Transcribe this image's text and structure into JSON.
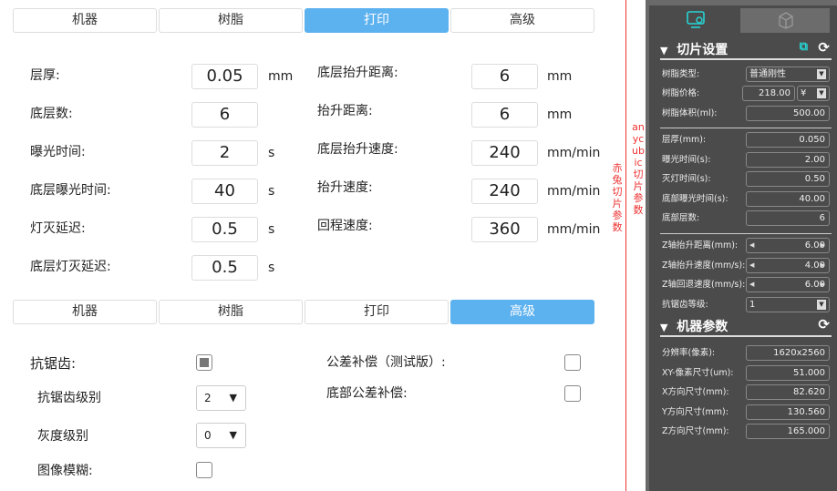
{
  "tabs_top": [
    "机器",
    "树脂",
    "打印",
    "高级"
  ],
  "print": {
    "left": [
      {
        "label": "层厚:",
        "value": "0.05",
        "unit": "mm"
      },
      {
        "label": "底层数:",
        "value": "6",
        "unit": ""
      },
      {
        "label": "曝光时间:",
        "value": "2",
        "unit": "s"
      },
      {
        "label": "底层曝光时间:",
        "value": "40",
        "unit": "s"
      },
      {
        "label": "灯灭延迟:",
        "value": "0.5",
        "unit": "s"
      },
      {
        "label": "底层灯灭延迟:",
        "value": "0.5",
        "unit": "s"
      }
    ],
    "right": [
      {
        "label": "底层抬升距离:",
        "value": "6",
        "unit": "mm"
      },
      {
        "label": "抬升距离:",
        "value": "6",
        "unit": "mm"
      },
      {
        "label": "底层抬升速度:",
        "value": "240",
        "unit": "mm/min"
      },
      {
        "label": "抬升速度:",
        "value": "240",
        "unit": "mm/min"
      },
      {
        "label": "回程速度:",
        "value": "360",
        "unit": "mm/min"
      }
    ]
  },
  "tabs_bottom": [
    "机器",
    "树脂",
    "打印",
    "高级"
  ],
  "advanced": {
    "antialias": "抗锯齿:",
    "antialias_level": "抗锯齿级别",
    "antialias_level_value": "2",
    "gray_level": "灰度级别",
    "gray_level_value": "0",
    "blur": "图像模糊:",
    "tolerance": "公差补偿（测试版）:",
    "bottom_tolerance": "底部公差补偿:"
  },
  "annotations": {
    "chitu": "赤兔切片参数",
    "anycubic": "anycubic切片参数"
  },
  "panel": {
    "slice_title": "切片设置",
    "resin_type_label": "树脂类型:",
    "resin_type": "普通刚性",
    "resin_price_label": "树脂价格:",
    "resin_price": "218.00",
    "currency": "¥",
    "resin_volume_label": "树脂体积(ml):",
    "resin_volume": "500.00",
    "fields": [
      {
        "label": "层厚(mm):",
        "value": "0.050"
      },
      {
        "label": "曝光时间(s):",
        "value": "2.00"
      },
      {
        "label": "灭灯时间(s):",
        "value": "0.50"
      },
      {
        "label": "底部曝光时间(s):",
        "value": "40.00"
      },
      {
        "label": "底部层数:",
        "value": "6"
      }
    ],
    "z": [
      {
        "label": "Z轴抬升距离(mm):",
        "value": "6.00"
      },
      {
        "label": "Z轴抬升速度(mm/s):",
        "value": "4.00"
      },
      {
        "label": "Z轴回退速度(mm/s):",
        "value": "6.00"
      }
    ],
    "aa_label": "抗锯齿等级:",
    "aa_value": "1",
    "machine_title": "机器参数",
    "machine": [
      {
        "label": "分辨率(像素):",
        "value": "1620x2560"
      },
      {
        "label": "XY-像素尺寸(um):",
        "value": "51.000"
      },
      {
        "label": "X方向尺寸(mm):",
        "value": "82.620"
      },
      {
        "label": "Y方向尺寸(mm):",
        "value": "130.560"
      },
      {
        "label": "Z方向尺寸(mm):",
        "value": "165.000"
      }
    ]
  }
}
